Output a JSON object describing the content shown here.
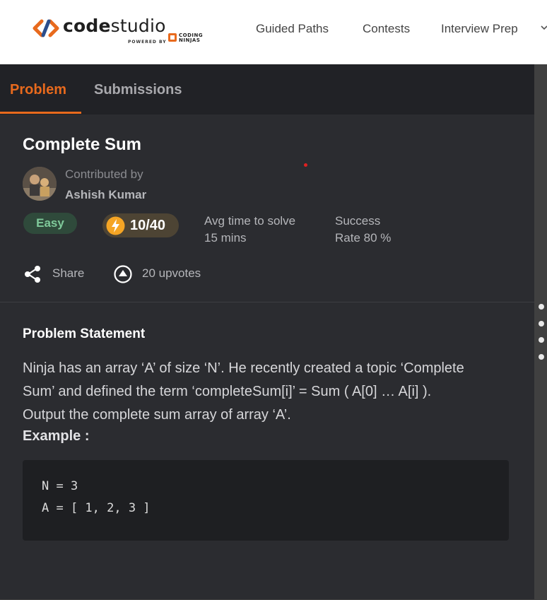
{
  "header": {
    "brand": {
      "code": "code",
      "studio": "studio",
      "powered_by": "POWERED BY",
      "coding": "CODING",
      "ninjas": "NINJAS"
    },
    "nav": [
      {
        "label": "Guided Paths"
      },
      {
        "label": "Contests"
      },
      {
        "label": "Interview Prep"
      }
    ]
  },
  "tabs": [
    {
      "label": "Problem",
      "active": true
    },
    {
      "label": "Submissions",
      "active": false
    }
  ],
  "problem": {
    "title": "Complete Sum",
    "contributed_by_label": "Contributed by",
    "contributor": "Ashish Kumar",
    "difficulty": "Easy",
    "points": "10/40",
    "avg_time_label": "Avg time to solve",
    "avg_time_value": "15 mins",
    "success_label": "Success",
    "success_value": "Rate 80 %",
    "share_label": "Share",
    "upvotes_label": "20 upvotes"
  },
  "statement": {
    "heading": "Problem Statement",
    "lines": [
      "Ninja has an array ‘A’ of size ‘N’. He recently created a topic ‘Complete",
      "Sum’ and defined the term ‘completeSum[i]’ = Sum ( A[0] … A[i] ).",
      "Output the complete sum array of array ‘A’."
    ],
    "example_label": "Example :",
    "code": [
      "N = 3",
      "A = [ 1, 2, 3 ]"
    ]
  },
  "colors": {
    "accent": "#e86a1d",
    "panel_bg": "#2b2c30",
    "tabs_bg": "#212226",
    "easy_bg": "#2f4a3b",
    "easy_text": "#7fc99a",
    "points_bg": "#4d4434"
  },
  "icons": [
    "codestudio-logo-icon",
    "coding-ninjas-logo-icon",
    "chevron-down-icon",
    "lightning-bolt-icon",
    "share-icon",
    "upvote-icon"
  ]
}
